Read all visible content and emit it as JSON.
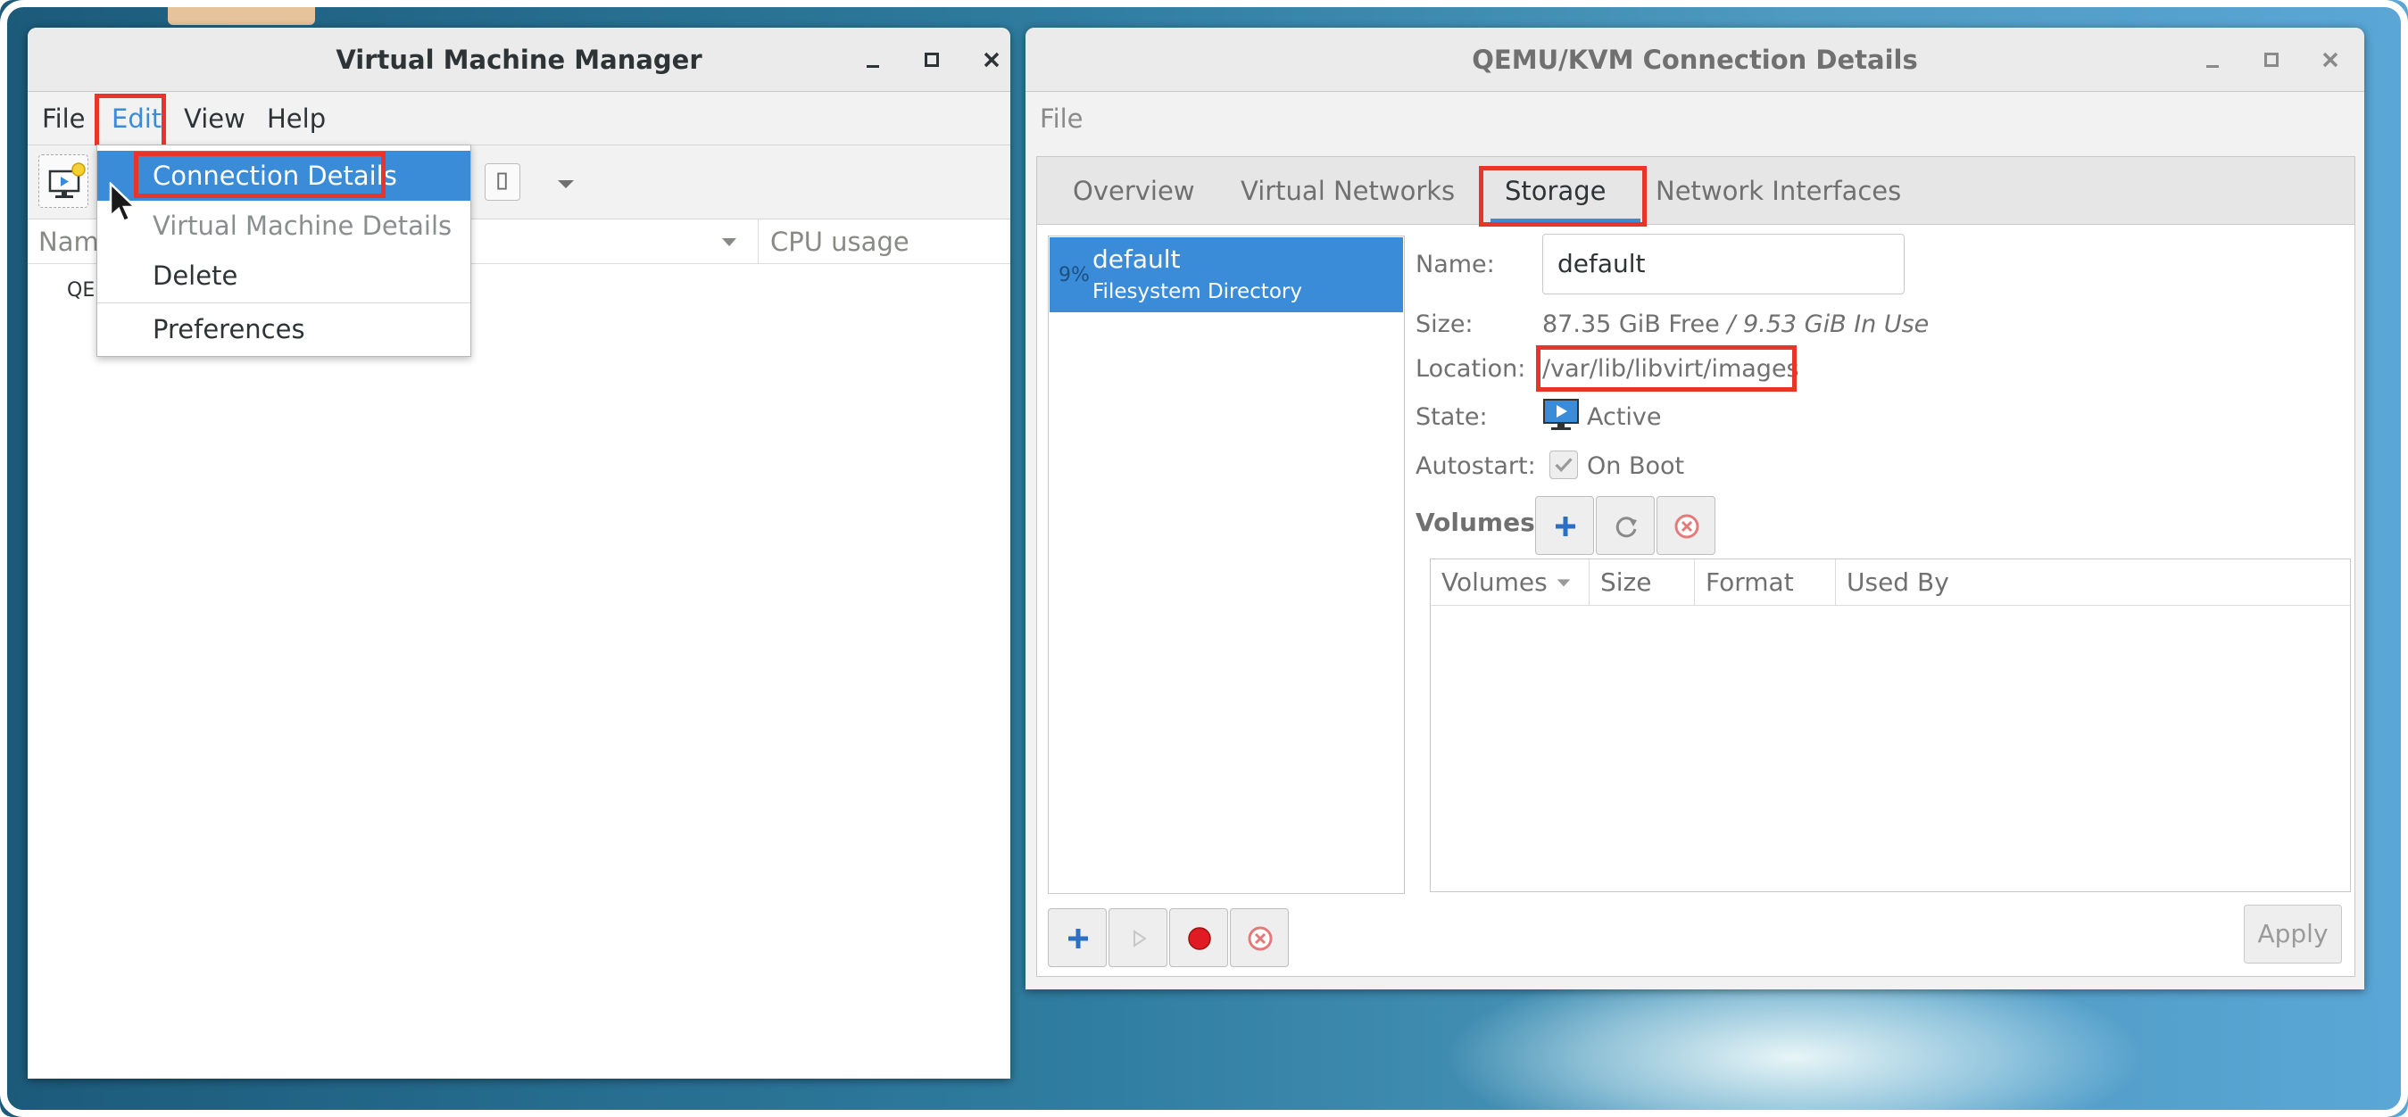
{
  "vmm": {
    "title": "Virtual Machine Manager",
    "menu": {
      "file": "File",
      "edit": "Edit",
      "view": "View",
      "help": "Help"
    },
    "list": {
      "col_name": "Name",
      "col_cpu": "CPU usage",
      "row_partial": "QE"
    }
  },
  "edit_menu": {
    "items": [
      {
        "label": "Connection Details",
        "state": "highlighted"
      },
      {
        "label": "Virtual Machine Details",
        "state": "disabled"
      },
      {
        "label": "Delete",
        "state": "normal"
      },
      {
        "label": "Preferences",
        "state": "normal"
      }
    ]
  },
  "conn": {
    "title": "QEMU/KVM Connection Details",
    "menu": {
      "file": "File"
    },
    "tabs": [
      "Overview",
      "Virtual Networks",
      "Storage",
      "Network Interfaces"
    ],
    "active_tab": "Storage",
    "pool": {
      "percent": "9%",
      "name": "default",
      "type": "Filesystem Directory"
    },
    "details": {
      "name_label": "Name:",
      "name_value": "default",
      "size_label": "Size:",
      "size_free": "87.35 GiB Free",
      "size_sep": " / ",
      "size_used": "9.53 GiB In Use",
      "location_label": "Location:",
      "location_value": "/var/lib/libvirt/images",
      "state_label": "State:",
      "state_value": "Active",
      "autostart_label": "Autostart:",
      "autostart_value": "On Boot"
    },
    "volumes": {
      "label": "Volumes",
      "columns": [
        "Volumes",
        "Size",
        "Format",
        "Used By"
      ]
    },
    "apply": "Apply"
  },
  "colors": {
    "accent": "#3a8cd8",
    "highlight_box": "#e8352a",
    "stop_red": "#e01b24"
  }
}
